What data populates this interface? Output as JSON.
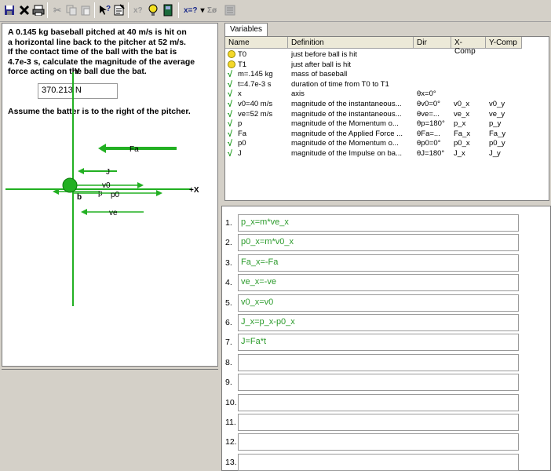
{
  "toolbar": {
    "drop_eq": "x=?",
    "drop_sum": "Σø"
  },
  "problem": {
    "text": "A 0.145 kg baseball pitched at 40 m/s is hit on\na horizontal line back to the pitcher at 52 m/s.\nIf the contact time of the ball with the bat is\n4.7e-3 s, calculate the magnitude of the average\nforce acting on the ball due the bat.",
    "answer": "370.213 N",
    "assume": "Assume the batter is to the right of the pitcher."
  },
  "diagram": {
    "axis_x": "X",
    "axis_y": "Y",
    "labels": {
      "fa": "Fa",
      "j": "J",
      "v0": "v0",
      "b": "b",
      "p": "p",
      "p0": "p0",
      "ve": "ve"
    },
    "color": "#22b022"
  },
  "variables": {
    "tab": "Variables",
    "headers": [
      "Name",
      "Definition",
      "Dir",
      "X-Comp",
      "Y-Comp"
    ],
    "rows": [
      {
        "icon": "smile",
        "name": "T0",
        "def": "just before ball is hit",
        "dir": "",
        "x": "",
        "y": ""
      },
      {
        "icon": "smile",
        "name": "T1",
        "def": "just after ball is hit",
        "dir": "",
        "x": "",
        "y": ""
      },
      {
        "icon": "check",
        "name": "m=.145 kg",
        "def": "mass of baseball",
        "dir": "",
        "x": "",
        "y": ""
      },
      {
        "icon": "check",
        "name": "t=4.7e-3 s",
        "def": "duration of time from T0 to T1",
        "dir": "",
        "x": "",
        "y": ""
      },
      {
        "icon": "check",
        "name": "x",
        "def": "axis",
        "dir": "θx=0°",
        "x": "",
        "y": ""
      },
      {
        "icon": "check",
        "name": "v0=40 m/s",
        "def": "magnitude of the instantaneous...",
        "dir": "θv0=0°",
        "x": "v0_x",
        "y": "v0_y"
      },
      {
        "icon": "check",
        "name": "ve=52 m/s",
        "def": "magnitude of the instantaneous...",
        "dir": "θve=...",
        "x": "ve_x",
        "y": "ve_y"
      },
      {
        "icon": "check",
        "name": "p",
        "def": "magnitude of the Momentum o...",
        "dir": "θp=180°",
        "x": "p_x",
        "y": "p_y"
      },
      {
        "icon": "check",
        "name": "Fa",
        "def": "magnitude of the Applied Force ...",
        "dir": "θFa=...",
        "x": "Fa_x",
        "y": "Fa_y"
      },
      {
        "icon": "check",
        "name": "p0",
        "def": "magnitude of the Momentum o...",
        "dir": "θp0=0°",
        "x": "p0_x",
        "y": "p0_y"
      },
      {
        "icon": "check",
        "name": "J",
        "def": "magnitude of the Impulse on ba...",
        "dir": "θJ=180°",
        "x": "J_x",
        "y": "J_y"
      }
    ]
  },
  "equations": [
    {
      "num": "1.",
      "text": "p_x=m*ve_x"
    },
    {
      "num": "2.",
      "text": "p0_x=m*v0_x"
    },
    {
      "num": "3.",
      "text": "Fa_x=-Fa"
    },
    {
      "num": "4.",
      "text": "ve_x=-ve"
    },
    {
      "num": "5.",
      "text": "v0_x=v0"
    },
    {
      "num": "6.",
      "text": "J_x=p_x-p0_x"
    },
    {
      "num": "7.",
      "text": "J=Fa*t"
    },
    {
      "num": "8.",
      "text": ""
    },
    {
      "num": "9.",
      "text": ""
    },
    {
      "num": "10.",
      "text": ""
    },
    {
      "num": "11.",
      "text": ""
    },
    {
      "num": "12.",
      "text": ""
    },
    {
      "num": "13.",
      "text": ""
    }
  ]
}
